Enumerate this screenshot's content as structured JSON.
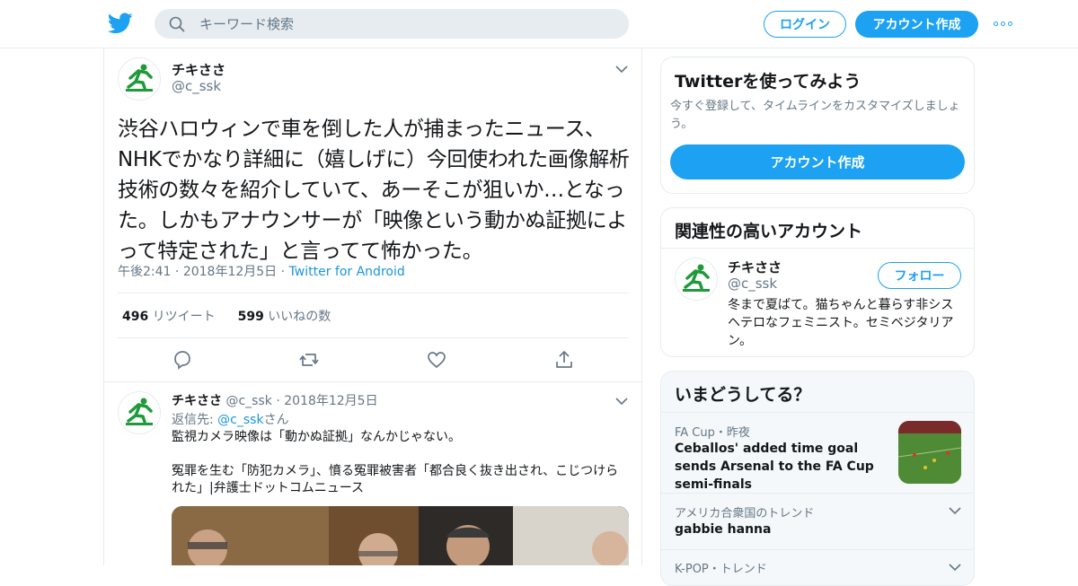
{
  "colors": {
    "accent": "#1da1f2",
    "link": "#1b95e0",
    "secondary_text": "#657786",
    "border": "#e6ecf0",
    "avatar_green": "#1f9a3a"
  },
  "header": {
    "search_placeholder": "キーワード検索",
    "login_label": "ログイン",
    "signup_label": "アカウント作成"
  },
  "tweet": {
    "author_name": "チキささ",
    "author_handle": "@c_ssk",
    "text": "渋谷ハロウィンで車を倒した人が捕まったニュース、NHKでかなり詳細に（嬉しげに）今回使われた画像解析技術の数々を紹介していて、あーそこが狙いか…となった。しかもアナウンサーが「映像という動かぬ証拠によって特定された」と言ってて怖かった。",
    "time": "午後2:41",
    "date": "2018年12月5日",
    "source": "Twitter for Android",
    "retweet_count": "496",
    "retweet_label": "リツイート",
    "like_count": "599",
    "like_label": "いいねの数"
  },
  "reply": {
    "author_name": "チキささ",
    "author_handle": "@c_ssk",
    "date": "2018年12月5日",
    "reply_prefix": "返信先:",
    "reply_target": "@c_ssk",
    "reply_suffix": "さん",
    "line1": "監視カメラ映像は「動かぬ証拠」なんかじゃない。",
    "line2": "冤罪を生む「防犯カメラ」、憤る冤罪被害者「都合良く抜き出され、こじつけられた」|弁護士ドットコムニュース"
  },
  "sidebar": {
    "signup_card": {
      "title": "Twitterを使ってみよう",
      "description": "今すぐ登録して、タイムラインをカスタマイズしましょう。",
      "button": "アカウント作成"
    },
    "related_card": {
      "title": "関連性の高いアカウント",
      "name": "チキささ",
      "handle": "@c_ssk",
      "follow_label": "フォロー",
      "bio": "冬まで夏ばて。猫ちゃんと暮らす非シスヘテロなフェミニスト。セミベジタリアン。"
    },
    "trends_card": {
      "title": "いまどうしてる？",
      "trend1_context": "FA Cup・昨夜",
      "trend1_title": "Ceballos' added time goal sends Arsenal to the FA Cup semi-finals",
      "trend2_context": "アメリカ合衆国のトレンド",
      "trend2_title": "gabbie hanna",
      "trend3_context": "K-POP・トレンド"
    }
  }
}
